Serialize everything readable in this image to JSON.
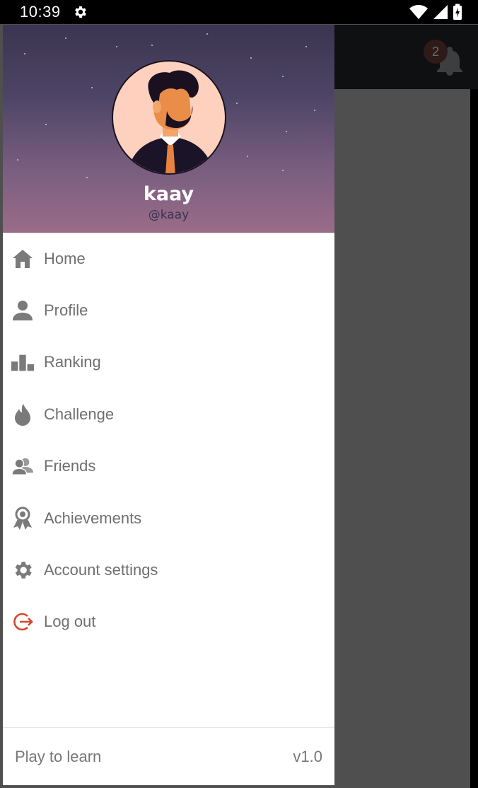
{
  "status_bar": {
    "time": "10:39",
    "icons": [
      "settings-icon",
      "wifi-icon",
      "signal-icon",
      "battery-charging-icon"
    ]
  },
  "background_app": {
    "notification_count": "2",
    "icon": "bell-icon"
  },
  "drawer": {
    "user": {
      "name": "kaay",
      "handle": "@kaay",
      "avatar": "avatar-bearded-man"
    },
    "menu": [
      {
        "label": "Home",
        "icon": "home-icon"
      },
      {
        "label": "Profile",
        "icon": "person-icon"
      },
      {
        "label": "Ranking",
        "icon": "podium-icon"
      },
      {
        "label": "Challenge",
        "icon": "flame-icon"
      },
      {
        "label": "Friends",
        "icon": "friends-icon"
      },
      {
        "label": "Achievements",
        "icon": "award-ribbon-icon"
      },
      {
        "label": "Account settings",
        "icon": "gear-icon"
      },
      {
        "label": "Log out",
        "icon": "logout-icon"
      }
    ],
    "footer": {
      "tagline": "Play to learn",
      "version": "v1.0"
    }
  },
  "colors": {
    "menu_text": "#6f6f6f",
    "menu_icon": "#7a7a7a",
    "logout_accent": "#d2472e",
    "scrim": "#4f4f4f",
    "header_top": "#3b3550",
    "header_bottom": "#9a6c88"
  }
}
